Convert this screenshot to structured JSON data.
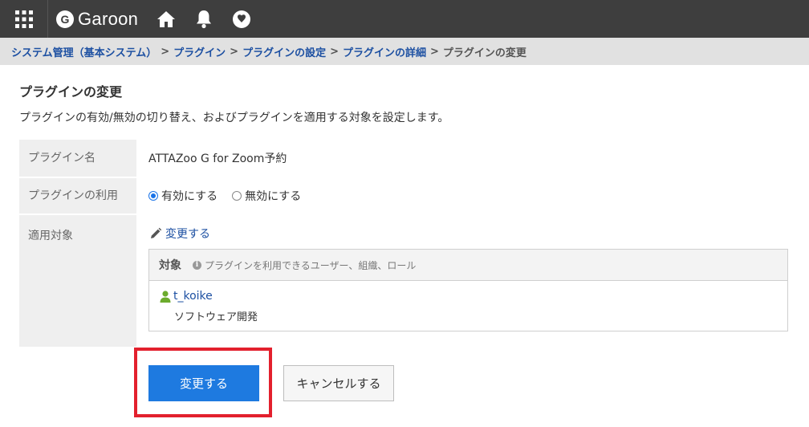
{
  "header": {
    "logo_text": "Garoon",
    "logo_mark": "G",
    "icons": [
      "apps-grid-icon",
      "home-icon",
      "bell-icon",
      "favorite-icon"
    ],
    "background": "#3e3e3e"
  },
  "breadcrumb": {
    "items": [
      "システム管理（基本システム）",
      "プラグイン",
      "プラグインの設定",
      "プラグインの詳細"
    ],
    "separator": ">",
    "current": "プラグインの変更",
    "link_color": "#1d50a2"
  },
  "page": {
    "title": "プラグインの変更",
    "description": "プラグインの有効/無効の切り替え、およびプラグインを適用する対象を設定します。"
  },
  "form": {
    "name_label": "プラグイン名",
    "name_value": "ATTAZoo G for Zoom予約",
    "usage_label": "プラグインの利用",
    "usage_options": [
      {
        "label": "有効にする",
        "selected": true
      },
      {
        "label": "無効にする",
        "selected": false
      }
    ],
    "target_label": "適用対象",
    "change_link": "変更する",
    "target_box": {
      "header": "対象",
      "hint": "プラグインを利用できるユーザー、組織、ロール",
      "user_name": "t_koike",
      "user_dept": "ソフトウェア開発"
    }
  },
  "actions": {
    "submit_label": "変更する",
    "cancel_label": "キャンセルする",
    "primary_color": "#1e7ae0",
    "highlight_color": "#e3202d"
  }
}
